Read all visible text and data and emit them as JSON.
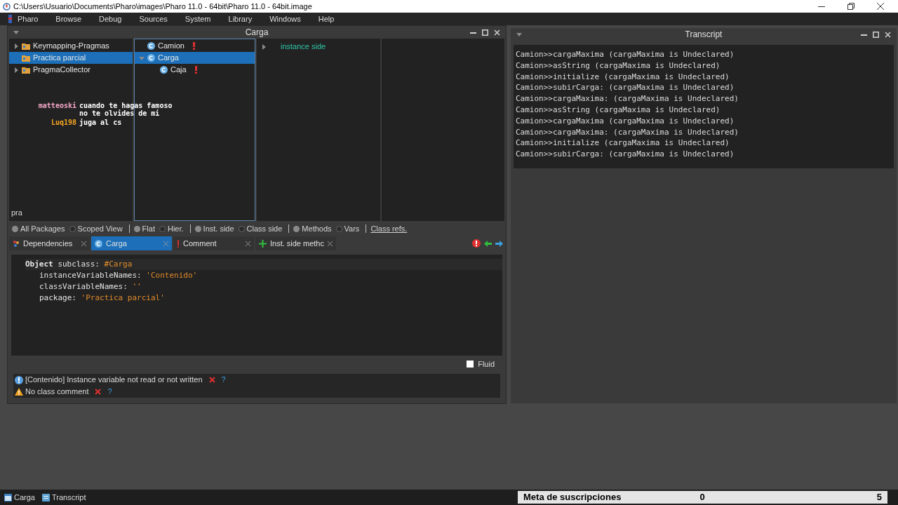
{
  "os_window": {
    "title": "C:\\Users\\Usuario\\Documents\\Pharo\\images\\Pharo 11.0 - 64bit\\Pharo 11.0 - 64bit.image"
  },
  "menu_bar": [
    "Pharo",
    "Browse",
    "Debug",
    "Sources",
    "System",
    "Library",
    "Windows",
    "Help"
  ],
  "browser": {
    "title": "Carga",
    "packages": [
      {
        "name": "Keymapping-Pragmas",
        "selected": false
      },
      {
        "name": "Practica parcial",
        "selected": true
      },
      {
        "name": "PragmaCollector",
        "selected": false
      }
    ],
    "package_filter": "pra",
    "classes": [
      {
        "name": "Camion",
        "selected": false,
        "warning": true
      },
      {
        "name": "Carga",
        "selected": true,
        "warning": false,
        "expanded": true,
        "children": [
          {
            "name": "Caja",
            "selected": false,
            "warning": true
          }
        ]
      }
    ],
    "protocols": [
      {
        "name": "instance side"
      }
    ],
    "view_options": [
      [
        {
          "label": "All Packages",
          "selected": true
        },
        {
          "label": "Scoped View",
          "selected": false
        }
      ],
      [
        {
          "label": "Flat",
          "selected": true
        },
        {
          "label": "Hier.",
          "selected": false
        }
      ],
      [
        {
          "label": "Inst. side",
          "selected": true
        },
        {
          "label": "Class side",
          "selected": false
        }
      ],
      [
        {
          "label": "Methods",
          "selected": true
        },
        {
          "label": "Vars",
          "selected": false
        }
      ]
    ],
    "class_refs_link": "Class refs.",
    "tabs": [
      {
        "kind": "dependencies",
        "label": "Dependencies",
        "selected": false
      },
      {
        "kind": "class",
        "label": "Carga",
        "selected": true
      },
      {
        "kind": "comment",
        "label": "Comment",
        "selected": false
      },
      {
        "kind": "add",
        "label": "Inst. side methc",
        "selected": false
      }
    ],
    "definition": {
      "receiver": "Object",
      "message": "subclass:",
      "symbol": "#Carga",
      "args": [
        {
          "keyword": "instanceVariableNames:",
          "value": "'Contenido'"
        },
        {
          "keyword": "classVariableNames:",
          "value": "''"
        },
        {
          "keyword": "package:",
          "value": "'Practica parcial'"
        }
      ]
    },
    "fluid": {
      "label": "Fluid",
      "checked": false
    },
    "critiques": [
      {
        "kind": "info",
        "text": "[Contenido] Instance variable not read or not written",
        "help": "?"
      },
      {
        "kind": "warning",
        "text": "No class comment",
        "help": "?"
      }
    ]
  },
  "chat": [
    {
      "user": "matteoski",
      "color": "#f4a6c8",
      "message": "cuando te hagas famoso no te olvides de mi"
    },
    {
      "user": "Luq198",
      "color": "#f5a623",
      "message": "juga al cs"
    }
  ],
  "transcript": {
    "title": "Transcript",
    "lines": [
      "Camion>>cargaMaxima (cargaMaxima is Undeclared)",
      "Camion>>asString (cargaMaxima is Undeclared)",
      "Camion>>initialize (cargaMaxima is Undeclared)",
      "Camion>>subirCarga: (cargaMaxima is Undeclared)",
      "Camion>>cargaMaxima: (cargaMaxima is Undeclared)",
      "Camion>>asString (cargaMaxima is Undeclared)",
      "Camion>>cargaMaxima (cargaMaxima is Undeclared)",
      "Camion>>cargaMaxima: (cargaMaxima is Undeclared)",
      "Camion>>initialize (cargaMaxima is Undeclared)",
      "Camion>>subirCarga: (cargaMaxima is Undeclared)"
    ]
  },
  "taskbar": [
    {
      "kind": "browser",
      "label": "Carga"
    },
    {
      "kind": "transcript",
      "label": "Transcript"
    }
  ],
  "goal": {
    "label": "Meta de suscripciones",
    "current": "0",
    "target": "5",
    "level": 0
  }
}
